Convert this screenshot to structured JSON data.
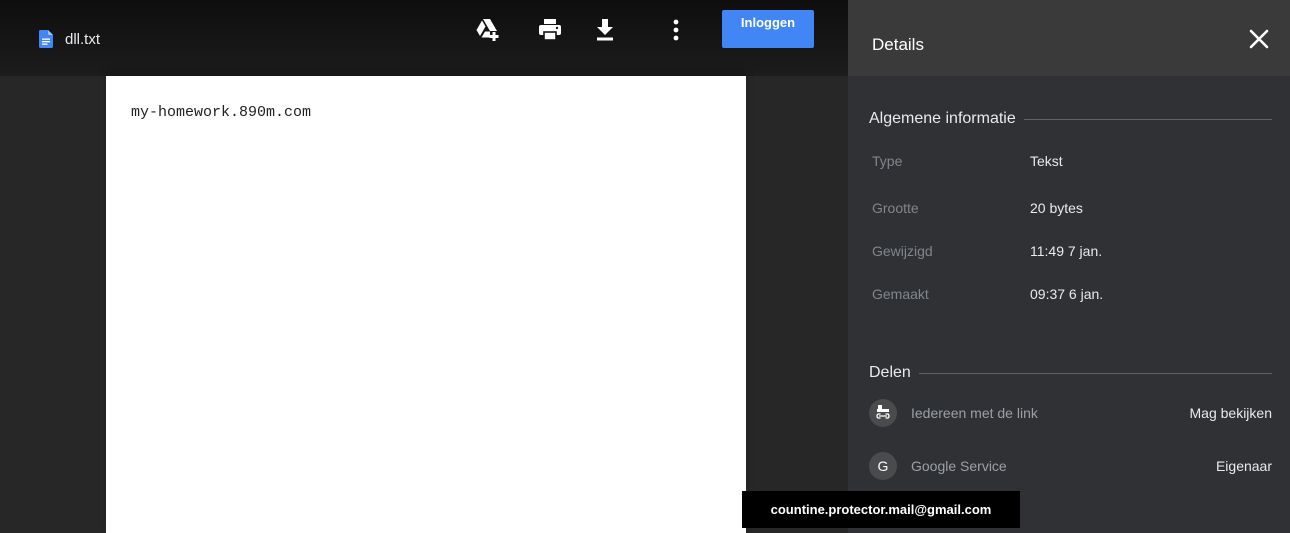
{
  "file": {
    "name": "dll.txt",
    "icon": "google-docs-icon",
    "icon_color": "#4285f4"
  },
  "toolbar": {
    "items": [
      {
        "icon": "add-to-drive-icon"
      },
      {
        "icon": "print-icon"
      },
      {
        "icon": "download-icon"
      },
      {
        "icon": "more-vert-icon"
      }
    ],
    "login_label": "Inloggen",
    "login_color": "#4285f4"
  },
  "document": {
    "content": "my-homework.890m.com"
  },
  "details": {
    "title": "Details",
    "general_title": "Algemene informatie",
    "rows": [
      {
        "label": "Type",
        "value": "Tekst"
      },
      {
        "label": "Grootte",
        "value": "20 bytes"
      },
      {
        "label": "Gewijzigd",
        "value": "11:49 7 jan."
      },
      {
        "label": "Gemaakt",
        "value": "09:37 6 jan."
      }
    ],
    "share_title": "Delen",
    "share": [
      {
        "icon": "link-share-icon",
        "who": "Iedereen met de link",
        "role": "Mag bekijken"
      },
      {
        "avatar": "G",
        "who": "Google Service",
        "role": "Eigenaar"
      }
    ]
  },
  "tooltip": {
    "text": "countine.protector.mail@gmail.com"
  }
}
